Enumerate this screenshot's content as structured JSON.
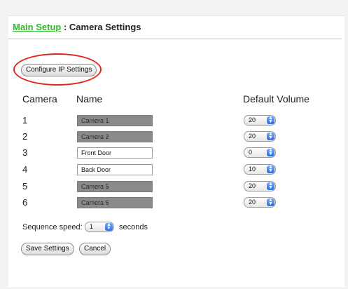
{
  "breadcrumb": {
    "link": "Main Setup",
    "separator": " : ",
    "current": "Camera Settings"
  },
  "configure_button": "Configure IP Settings",
  "columns": {
    "camera": "Camera",
    "name": "Name",
    "volume": "Default Volume"
  },
  "rows": [
    {
      "number": "1",
      "name": "Camera 1",
      "volume": "20"
    },
    {
      "number": "2",
      "name": "Camera 2",
      "volume": "20"
    },
    {
      "number": "3",
      "name": "Front Door",
      "volume": "0"
    },
    {
      "number": "4",
      "name": "Back Door",
      "volume": "10"
    },
    {
      "number": "5",
      "name": "Camera 5",
      "volume": "20"
    },
    {
      "number": "6",
      "name": "Camera 6",
      "volume": "20"
    }
  ],
  "sequence": {
    "label": "Sequence speed:",
    "value": "1",
    "suffix": "seconds"
  },
  "buttons": {
    "save": "Save Settings",
    "cancel": "Cancel"
  },
  "icons": {
    "select_arrows": "up-down-arrows-icon"
  },
  "colors": {
    "link": "#2db82d",
    "highlight": "#e0261f",
    "disabled_field": "#8a8a8a"
  }
}
